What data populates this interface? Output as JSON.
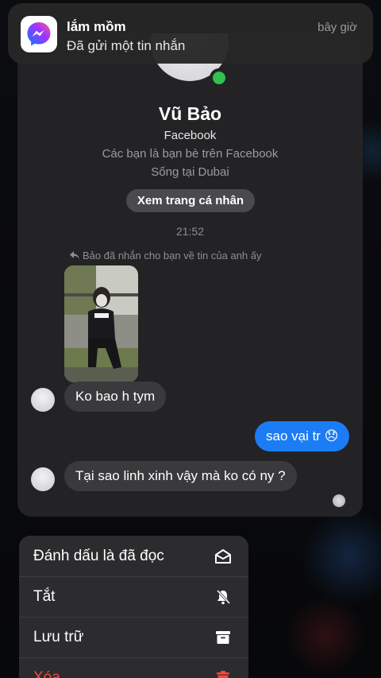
{
  "notification": {
    "title": "lắm mồm",
    "message": "Đã gửi một tin nhắn",
    "time": "bây giờ",
    "app_icon": "messenger-icon"
  },
  "chat": {
    "contact_name": "Vũ Bảo",
    "platform": "Facebook",
    "friend_status": "Các bạn là bạn bè trên Facebook",
    "location": "Sống tại Dubai",
    "profile_button": "Xem trang cá nhân",
    "timestamp": "21:52",
    "reply_note": "Bảo đã nhắn cho bạn về tin của anh ấy",
    "messages": [
      {
        "direction": "in",
        "text": "Ko bao h tym"
      },
      {
        "direction": "out",
        "text": "sao vại tr 😞"
      },
      {
        "direction": "in",
        "text": "Tại sao linh xinh vậy mà ko có ny ?"
      }
    ]
  },
  "menu": {
    "items": [
      {
        "label": "Đánh dấu là đã đọc",
        "icon": "envelope-open-icon"
      },
      {
        "label": "Tắt",
        "icon": "bell-slash-icon"
      },
      {
        "label": "Lưu trữ",
        "icon": "archive-box-icon"
      },
      {
        "label": "Xóa",
        "icon": "trash-icon"
      }
    ]
  },
  "colors": {
    "online": "#31c24b",
    "outgoing_bubble": "#1b7cf5",
    "incoming_bubble": "#3a3a3c",
    "danger": "#ff453a"
  }
}
